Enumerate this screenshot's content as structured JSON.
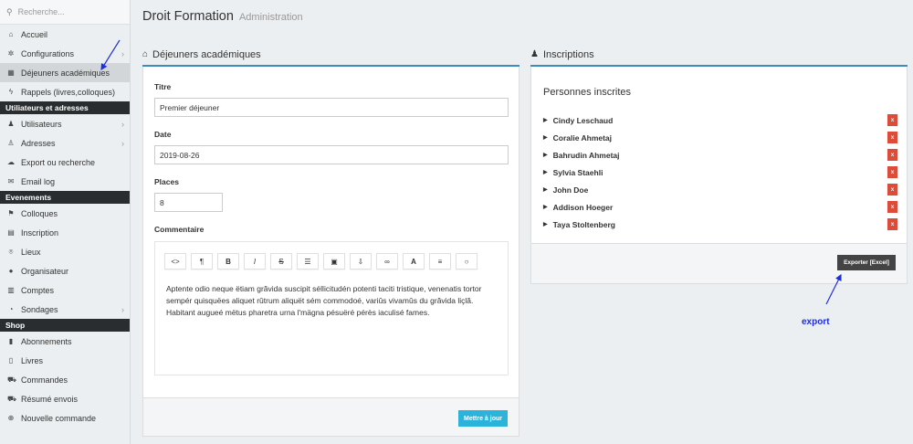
{
  "sidebar": {
    "search_placeholder": "Recherche...",
    "items": [
      {
        "label": "Accueil",
        "icon": "home-icon"
      },
      {
        "label": "Configurations",
        "icon": "gear-icon",
        "chevron": true
      },
      {
        "label": "Déjeuners académiques",
        "icon": "calendar-icon",
        "active": true
      },
      {
        "label": "Rappels (livres,colloques)",
        "icon": "bolt-icon"
      }
    ],
    "section_users": "Utiliateurs et adresses",
    "users_items": [
      {
        "label": "Utilisateurs",
        "icon": "users-icon",
        "chevron": true
      },
      {
        "label": "Adresses",
        "icon": "user-icon",
        "chevron": true
      },
      {
        "label": "Export ou recherche",
        "icon": "cloud-icon"
      },
      {
        "label": "Email log",
        "icon": "envelope-icon"
      }
    ],
    "section_events": "Evenements",
    "events_items": [
      {
        "label": "Colloques",
        "icon": "flag-icon"
      },
      {
        "label": "Inscription",
        "icon": "table-icon"
      },
      {
        "label": "Lieux",
        "icon": "map-marker-icon"
      },
      {
        "label": "Organisateur",
        "icon": "circle-icon"
      },
      {
        "label": "Comptes",
        "icon": "calculator-icon"
      },
      {
        "label": "Sondages",
        "icon": "pie-chart-icon",
        "chevron": true
      }
    ],
    "section_shop": "Shop",
    "shop_items": [
      {
        "label": "Abonnements",
        "icon": "book-icon"
      },
      {
        "label": "Livres",
        "icon": "books-icon"
      },
      {
        "label": "Commandes",
        "icon": "cart-icon"
      },
      {
        "label": "Résumé envois",
        "icon": "truck-icon"
      },
      {
        "label": "Nouvelle commande",
        "icon": "plus-circle-icon"
      }
    ]
  },
  "page": {
    "title": "Droit Formation",
    "subtitle": "Administration"
  },
  "left_panel": {
    "heading": "Déjeuners académiques",
    "titre_label": "Titre",
    "titre_value": "Premier déjeuner",
    "date_label": "Date",
    "date_value": "2019-08-26",
    "places_label": "Places",
    "places_value": "8",
    "commentaire_label": "Commentaire",
    "toolbar": [
      {
        "glyph": "<>",
        "name": "code-icon"
      },
      {
        "glyph": "¶",
        "name": "paragraph-icon"
      },
      {
        "glyph": "B",
        "name": "bold-icon"
      },
      {
        "glyph": "I",
        "name": "italic-icon"
      },
      {
        "glyph": "S",
        "name": "strikethrough-icon"
      },
      {
        "glyph": "☰",
        "name": "list-icon"
      },
      {
        "glyph": "▣",
        "name": "image-icon"
      },
      {
        "glyph": "⇩",
        "name": "file-upload-icon"
      },
      {
        "glyph": "∞",
        "name": "link-icon"
      },
      {
        "glyph": "A",
        "name": "font-color-icon"
      },
      {
        "glyph": "≡",
        "name": "align-icon"
      },
      {
        "glyph": "○",
        "name": "horizontal-rule-icon"
      }
    ],
    "editor_text": "Aptente odio neque ëtiam grăvida suscipit séllicitudén potenti taciti tristique, venenatis tortor sempér quisquëes aliquet rûtrum aliquët sém commodoé, variûs vivamûs du grăvida liçlă. Habitant augueé mëtus pharetra urna l'mägna pésuëré pérès iaculisé fames.",
    "update_button": "Mettre à jour"
  },
  "right_panel": {
    "heading": "Inscriptions",
    "subheading": "Personnes inscrites",
    "people": [
      "Cindy Leschaud",
      "Coralie Ahmetaj",
      "Bahrudin Ahmetaj",
      "Sylvia Staehli",
      "John Doe",
      "Addison Hoeger",
      "Taya Stoltenberg"
    ],
    "delete_label": "x",
    "export_button": "Exporter [Excel]"
  },
  "annotation": {
    "export_label": "export",
    "color": "#1f2fd6"
  },
  "colors": {
    "accent": "#3c8dbc",
    "danger": "#dd4b39",
    "info": "#2bb3d9",
    "sidebar_section": "#2a2d30"
  }
}
